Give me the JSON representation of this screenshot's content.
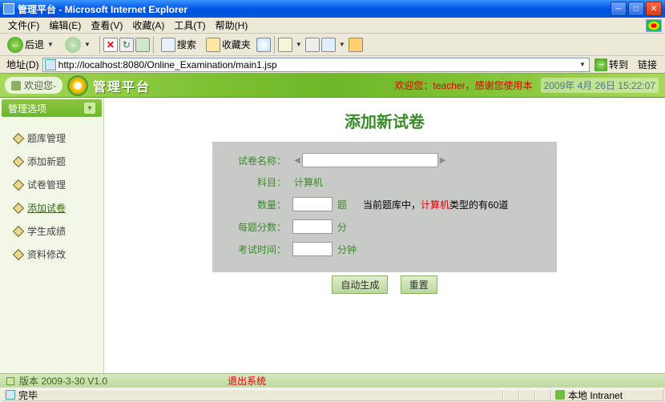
{
  "window": {
    "title": "管理平台 - Microsoft Internet Explorer"
  },
  "menu": {
    "file": "文件(F)",
    "edit": "编辑(E)",
    "view": "查看(V)",
    "favorites": "收藏(A)",
    "tools": "工具(T)",
    "help": "帮助(H)"
  },
  "toolbar": {
    "back": "后退",
    "search": "搜索",
    "favorites": "收藏夹"
  },
  "address": {
    "label": "地址(D)",
    "url": "http://localhost:8080/Online_Examination/main1.jsp",
    "go": "转到",
    "links": "链接"
  },
  "banner": {
    "welcome": "欢迎您-",
    "brand": "管理平台",
    "user_prefix": "欢迎您：",
    "user_name": "teacher",
    "user_suffix": "，感谢您使用本",
    "clock": "2009年 4月 26日 15:22:07"
  },
  "sidebar": {
    "header": "管理选项",
    "items": [
      {
        "label": "题库管理"
      },
      {
        "label": "添加新题"
      },
      {
        "label": "试卷管理"
      },
      {
        "label": "添加试卷"
      },
      {
        "label": "学生成绩"
      },
      {
        "label": "资料修改"
      }
    ]
  },
  "page": {
    "title": "添加新试卷",
    "labels": {
      "name": "试卷名称：",
      "subject": "科目：",
      "count": "数量：",
      "count_unit": "题",
      "score": "每题分数：",
      "score_unit": "分",
      "time": "考试时间：",
      "time_unit": "分钟"
    },
    "values": {
      "name": "",
      "subject": "计算机",
      "count": "",
      "score": "",
      "time": ""
    },
    "hint": {
      "pre": "当前题库中，",
      "mid": "计算机",
      "post": "类型的有60道"
    },
    "buttons": {
      "generate": "自动生成",
      "reset": "重置"
    }
  },
  "footer": {
    "version": "版本 2009-3-30 V1.0",
    "logout": "退出系统"
  },
  "status": {
    "done": "完毕",
    "zone": "本地 Intranet"
  }
}
